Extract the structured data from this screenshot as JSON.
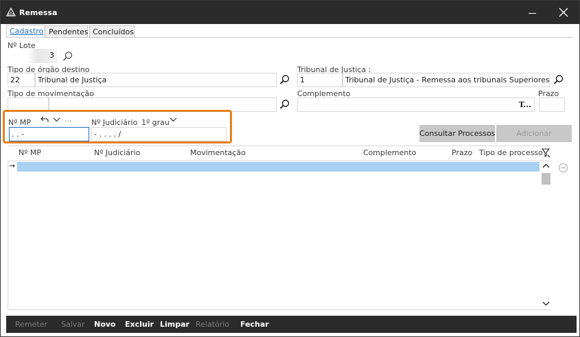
{
  "window": {
    "title": "Remessa"
  },
  "tabs": [
    {
      "label": "Cadastro"
    },
    {
      "label": "Pendentes"
    },
    {
      "label": "Concluídos"
    }
  ],
  "form": {
    "lote": {
      "label": "Nº Lote",
      "value": "3"
    },
    "tipo_orgao": {
      "label": "Tipo de órgão destino",
      "code": "22",
      "name": "Tribunal de Justiça"
    },
    "tribunal": {
      "label": "Tribunal de Justiça :",
      "code": "1",
      "name": "Tribunal de Justiça - Remessa aos tribunais Superiores"
    },
    "tipo_mov": {
      "label": "Tipo de movimentação",
      "code": "",
      "name": ""
    },
    "complemento": {
      "label": "Complemento",
      "value": "",
      "suffix": "T..."
    },
    "prazo": {
      "label": "Prazo",
      "value": ""
    },
    "mp": {
      "label": "Nº MP",
      "value": " .  .      -",
      "menu_dots": "···"
    },
    "judiciario": {
      "label": "Nº Judiciário",
      "grau": "1º grau",
      "value": "    -  .   . . .  /"
    }
  },
  "buttons": {
    "consultar": "Consultar Processos",
    "adicionar": "Adicionar"
  },
  "grid": {
    "columns": [
      "Nº MP",
      "Nº Judiciário",
      "Movimentação",
      "Complemento",
      "Prazo",
      "Tipo de processo"
    ],
    "row_marker": "→"
  },
  "footer": {
    "remeter": "Remeter",
    "salvar": "Salvar",
    "novo": "Novo",
    "excluir": "Excluir",
    "limpar": "Limpar",
    "relatorio": "Relatório",
    "fechar": "Fechar"
  },
  "colors": {
    "titlebar": "#2b2b2b",
    "highlight": "#e8801a",
    "selected_row": "#a8d0f0",
    "active_tab": "#1f6fc5"
  }
}
